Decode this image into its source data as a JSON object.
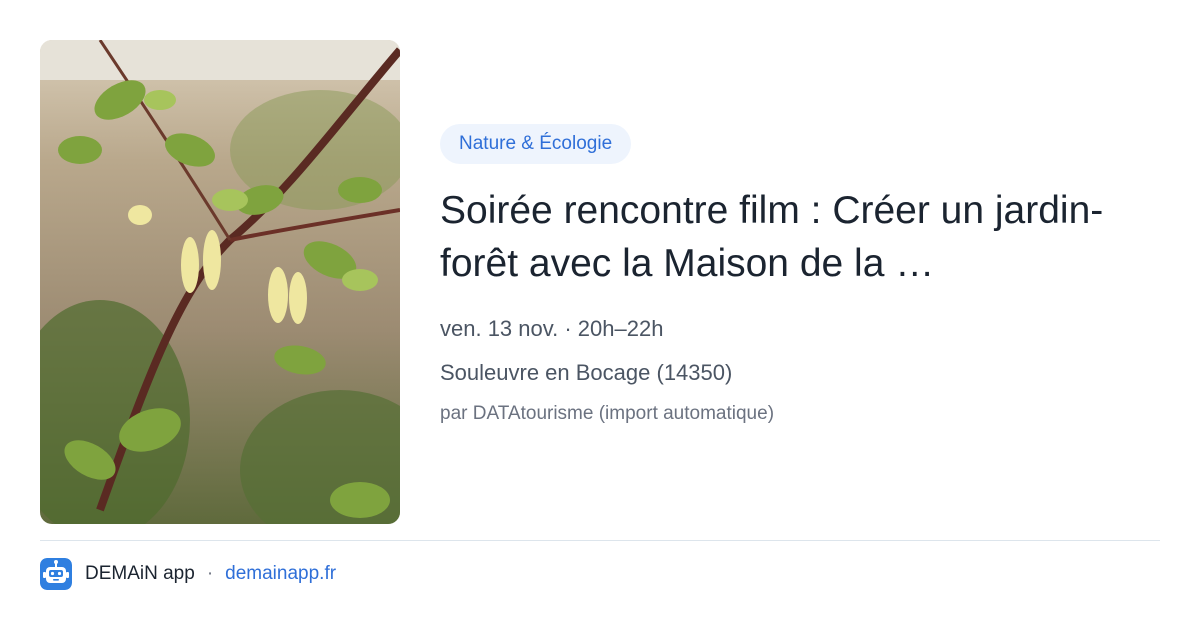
{
  "event": {
    "category": "Nature & Écologie",
    "title": "Soirée rencontre film : Créer un jardin-forêt avec la Maison de la …",
    "date": "ven. 13 nov. · 20h–22h",
    "location": "Souleuvre en Bocage (14350)",
    "source": "par DATAtourisme (import automatique)",
    "image_subject": "honeysuckle-branch-photo"
  },
  "footer": {
    "app_name": "DEMAiN app",
    "separator": "·",
    "site": "demainapp.fr",
    "logo_icon": "demain-robot-logo-icon"
  },
  "colors": {
    "accent": "#2f6fd8",
    "badge_bg": "#eef4fd",
    "title": "#1b2430",
    "muted": "#4b5563",
    "divider": "#dde5ec"
  }
}
